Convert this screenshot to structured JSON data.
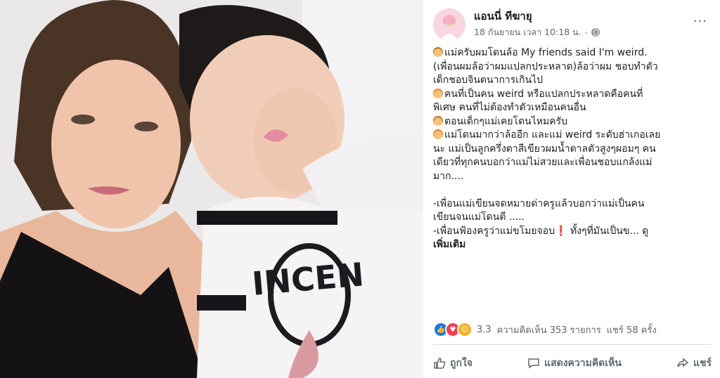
{
  "post": {
    "author": "แอนนี่ ทีฆายุ",
    "timestamp": "18 กันยายน เวลา 10:18 น.",
    "separator": "·",
    "more_label": "···",
    "lines": [
      {
        "emoji": "boy",
        "text": "แม่ครับผมโดนล้อ My friends said I'm weird."
      },
      {
        "text": "(เพื่อนผมล้อว่าผมแปลกประหลาด)ล้อว่าผม ชอบทำตัว"
      },
      {
        "text": "เด็กชอบจินตนาการเกินไป"
      },
      {
        "emoji": "girl",
        "text": "คนที่เป็นคน weird หรือแปลกประหลาดคือคนที่"
      },
      {
        "text": "พิเศษ คนที่ไม่ต้องทำตัวเหมือนคนอื่น"
      },
      {
        "emoji": "boy",
        "text": "ตอนเด็กๆแม่เคยโดนไหมครับ"
      },
      {
        "emoji": "girl",
        "text": "แม่โดนมากว่าล้ออีก และแม่ weird ระดับฮ่าเกอเลย"
      },
      {
        "text": "นะ แม่เป็นลูกครึ่งตาสีเขียวผมน้ำตาลตัวสูงๆผอมๆ คน"
      },
      {
        "text": "เดียวที่ทุกคนบอกว่าแม่ไม่สวยและเพื่อนชอบแกล้งแม่"
      },
      {
        "text": "มาก...."
      },
      {
        "text": ""
      },
      {
        "text": "-เพื่อนแม่เขียนจดหมายด่าครูแล้วบอกว่าแม่เป็นคน"
      },
      {
        "text": "เขียนจนแม่โดนตี ....."
      },
      {
        "text": "-เพื่อนฟ้องครูว่าแม่ขโมยจอบ",
        "excl": "❗",
        "tail": " ทั้งๆที่มันเป็นข... ดู"
      }
    ],
    "see_more": "เพิ่มเติม"
  },
  "stats": {
    "reaction_count": "3.3",
    "comments": "ความคิดเห็น 353 รายการ",
    "shares": "แชร์ 58 ครั้ง"
  },
  "actions": {
    "like": "ถูกใจ",
    "comment": "แสดงความคิดเห็น",
    "share": "แชร์"
  },
  "colors": {
    "like": "#1877f2",
    "love": "#f33e58",
    "haha": "#f7b125",
    "text": "#1c1e21",
    "muted": "#606770"
  }
}
